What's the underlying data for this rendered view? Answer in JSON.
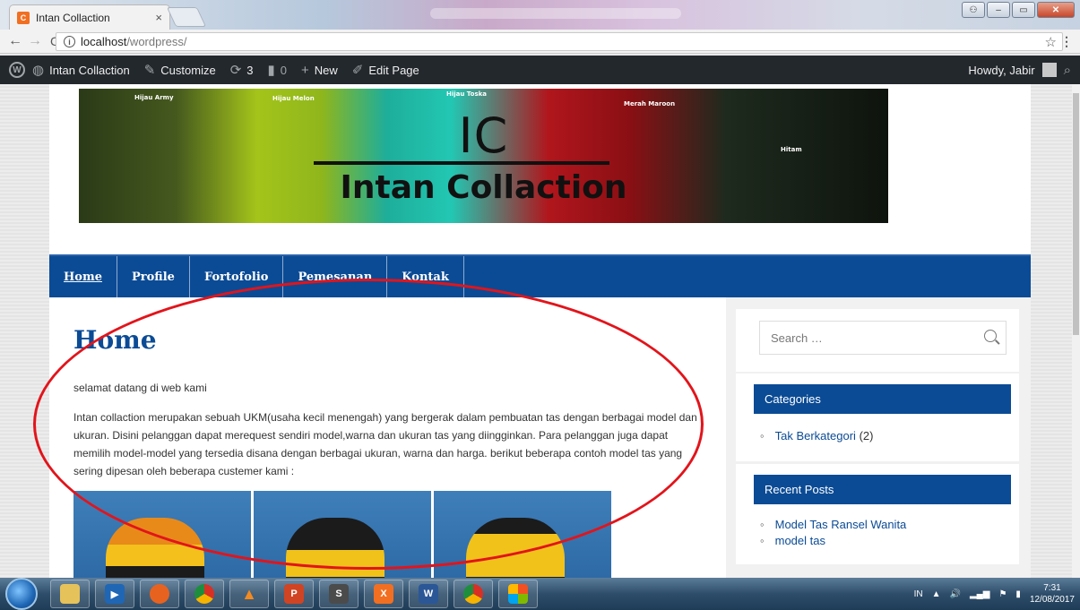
{
  "browser": {
    "tab_title": "Intan Collaction",
    "tab_close": "×",
    "url_host": "localhost",
    "url_path": "/wordpress/"
  },
  "admin_bar": {
    "site_name": "Intan Collaction",
    "customize": "Customize",
    "updates_count": "3",
    "comments_count": "0",
    "new_label": "New",
    "edit_page": "Edit Page",
    "howdy": "Howdy, Jabir"
  },
  "banner": {
    "bag_labels": [
      "Hijau Army",
      "Hijau Melon",
      "Hijau Toska",
      "Merah Maroon",
      "Hitam"
    ],
    "logo_short": "IC",
    "logo_name": "Intan Collaction"
  },
  "nav": {
    "items": [
      "Home",
      "Profile",
      "Fortofolio",
      "Pemesanan",
      "Kontak"
    ]
  },
  "content": {
    "title": "Home",
    "intro": "selamat datang di web kami",
    "body": "Intan collaction merupakan sebuah UKM(usaha kecil menengah) yang bergerak dalam pembuatan tas dengan berbagai model dan ukuran. Disini pelanggan dapat merequest sendiri model,warna dan ukuran tas yang diingginkan. Para pelanggan juga dapat memilih model-model yang tersedia disana dengan berbagai ukuran, warna dan harga. berikut beberapa contoh model tas yang sering dipesan oleh beberapa custemer kami :"
  },
  "sidebar": {
    "search_placeholder": "Search …",
    "categories_title": "Categories",
    "category_name": "Tak Berkategori",
    "category_count": "(2)",
    "recent_title": "Recent Posts",
    "recent_posts": [
      "Model Tas Ransel Wanita",
      "model tas"
    ]
  },
  "taskbar": {
    "lang": "IN",
    "time": "7:31",
    "date": "12/08/2017"
  },
  "colors": {
    "brand_blue": "#0b4b95",
    "annotation_red": "#e2141b"
  }
}
